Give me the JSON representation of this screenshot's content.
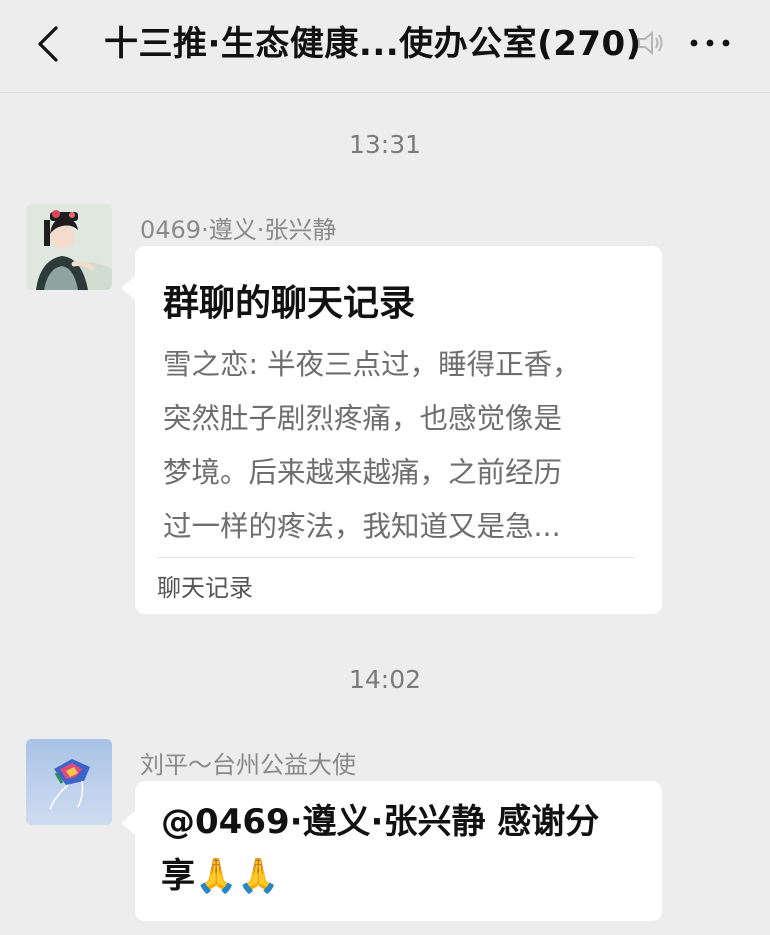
{
  "header": {
    "title": "十三推·生态健康...使办公室(270)",
    "back_icon": "chevron-left-icon",
    "mute_icon": "mute-icon",
    "more_icon": "more-icon"
  },
  "messages": [
    {
      "time": "13:31",
      "sender": "0469·遵义·张兴静",
      "avatar": "avatar-woman-traditional-costume",
      "card": {
        "title": "群聊的聊天记录",
        "lines": [
          "雪之恋: 半夜三点过，睡得正香，",
          "突然肚子剧烈疼痛，也感觉像是",
          "梦境。后来越来越痛，之前经历",
          "过一样的疼法，我知道又是急..."
        ],
        "footer": "聊天记录"
      }
    },
    {
      "time": "14:02",
      "sender": "刘平～台州公益大使",
      "avatar": "avatar-kite",
      "text_line1": "@0469·遵义·张兴静  感谢分",
      "text_line2": "享",
      "emoji": "🙏🙏"
    }
  ]
}
